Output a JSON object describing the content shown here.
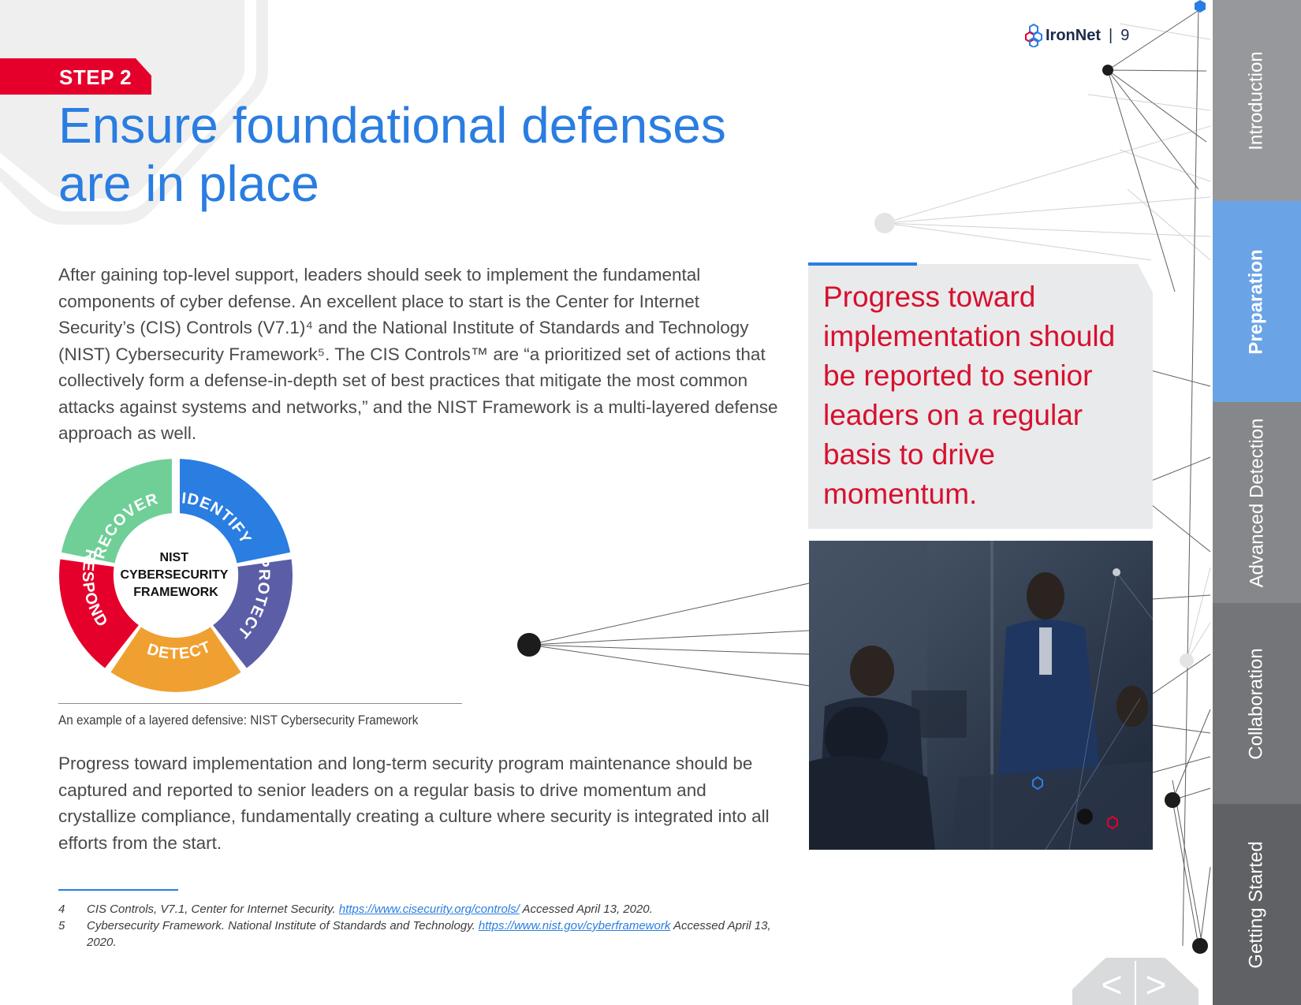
{
  "header": {
    "logo_text": "IronNet",
    "separator": "|",
    "page_number": "9"
  },
  "step_label": "STEP 2",
  "title": "Ensure foundational defenses are in place",
  "paragraph1": "After gaining top-level support, leaders should seek to implement the fundamental components of cyber defense. An excellent place to start is the Center for Internet Security’s (CIS) Controls (V7.1)⁴ and the National Institute of Standards and Technology (NIST) Cybersecurity Framework⁵. The CIS Controls™ are “a prioritized set of actions that collectively form a defense-in-depth set of best practices that mitigate the most common attacks against systems and networks,” and the NIST Framework is a multi-layered defense approach as well.",
  "nist_wheel": {
    "center_line1": "NIST",
    "center_line2": "CYBERSECURITY",
    "center_line3": "FRAMEWORK",
    "segments": [
      "IDENTIFY",
      "PROTECT",
      "DETECT",
      "RESPOND",
      "RECOVER"
    ],
    "colors": {
      "identify": "#2a7de1",
      "protect": "#5b5ea6",
      "detect": "#f0a030",
      "respond": "#e4002b",
      "recover": "#6fcf97"
    },
    "caption": "An example of a layered defensive: NIST Cybersecurity Framework"
  },
  "paragraph2": "Progress toward implementation and long-term security program maintenance should be captured and reported to senior leaders on a regular basis to drive momentum and crystallize compliance, fundamentally creating a culture where security is integrated into all efforts from the start.",
  "callout": "Progress toward implementation should be reported to senior leaders on a regular basis to drive momentum.",
  "footnotes": [
    {
      "num": "4",
      "text": "CIS Controls, V7.1, Center for Internet Security. ",
      "link": "https://www.cisecurity.org/controls/",
      "after": " Accessed April 13, 2020."
    },
    {
      "num": "5",
      "text": "Cybersecurity Framework. National Institute of Standards and Technology. ",
      "link": "https://www.nist.gov/cyberframework",
      "after": " Accessed April 13, 2020."
    }
  ],
  "sidebar_tabs": [
    "Introduction",
    "Preparation",
    "Advanced Detection",
    "Collaboration",
    "Getting Started"
  ],
  "nav": {
    "prev": "<",
    "next": ">"
  },
  "accent_colors": {
    "blue": "#2a7de1",
    "red": "#e4002b",
    "callout_text": "#d7102f"
  }
}
